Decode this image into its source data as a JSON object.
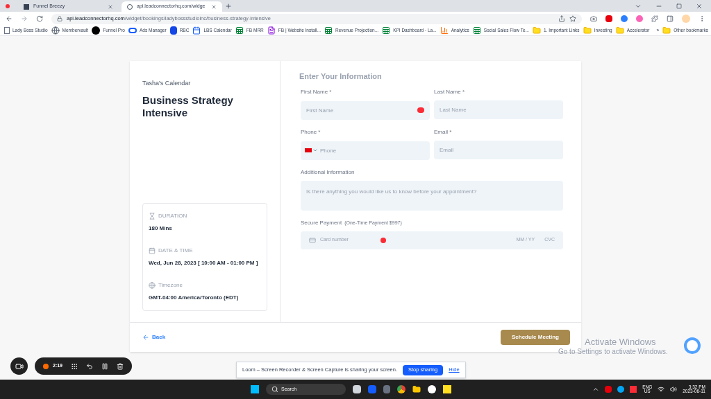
{
  "browser": {
    "tabs": [
      {
        "title": "Funnel Breezy",
        "selected": false
      },
      {
        "title": "api.leadconnectorhq.com/widge",
        "selected": true
      }
    ],
    "address": {
      "domain": "api.leadconnectorhq.com",
      "path": "/widget/bookings/ladybossstudioinc/business-strategy-intensive"
    },
    "bookmarks": [
      {
        "label": "Lady Boss Studio",
        "kind": "logo"
      },
      {
        "label": "Membervault",
        "kind": "globe"
      },
      {
        "label": "Funnel Pro",
        "kind": "dark"
      },
      {
        "label": "Ads Manager",
        "kind": "meta"
      },
      {
        "label": "RBC",
        "kind": "bank"
      },
      {
        "label": "LBS Calendar",
        "kind": "calendar"
      },
      {
        "label": "FB MRR",
        "kind": "sheet"
      },
      {
        "label": "FB | Website Install...",
        "kind": "form"
      },
      {
        "label": "Revenue Projection...",
        "kind": "sheet"
      },
      {
        "label": "KPI Dashboard - La...",
        "kind": "sheet"
      },
      {
        "label": "Analytics",
        "kind": "analytics"
      },
      {
        "label": "Social Sales Flow Te...",
        "kind": "sheet"
      },
      {
        "label": "1. Important Links",
        "kind": "folder"
      },
      {
        "label": "Investing",
        "kind": "folder"
      },
      {
        "label": "Accelerator",
        "kind": "folder"
      }
    ],
    "more": "»",
    "other_bookmarks": "Other bookmarks"
  },
  "booking": {
    "calendar_name": "Tasha's Calendar",
    "title": "Business Strategy Intensive",
    "details": [
      {
        "kind": "duration",
        "label": "DURATION",
        "value": "180 Mins"
      },
      {
        "kind": "datetime",
        "label": "DATE & TIME",
        "value": "Wed, Jun 28, 2023 [ 10:00 AM - 01:00 PM ]"
      },
      {
        "kind": "timezone",
        "label": "Timezone",
        "value": "GMT-04:00 America/Toronto (EDT)"
      }
    ],
    "form_heading": "Enter Your Information",
    "fields": [
      {
        "kind": "text",
        "label": "First Name *",
        "placeholder": "First Name"
      },
      {
        "kind": "text",
        "label": "Last Name *",
        "placeholder": "Last Name"
      },
      {
        "kind": "phone",
        "label": "Phone *",
        "placeholder": "Phone"
      },
      {
        "kind": "text",
        "label": "Email *",
        "placeholder": "Email"
      },
      {
        "kind": "textarea",
        "label": "Additional Information",
        "placeholder": "Is there anything you would like us to know before your appointment?"
      }
    ],
    "payment": {
      "label": "Secure Payment",
      "note": "(One-Time Payment $997)",
      "card_placeholder": "Card number",
      "expiry_placeholder": "MM / YY",
      "cvc_placeholder": "CVC"
    },
    "back": "Back",
    "submit": "Schedule Meeting"
  },
  "activation": {
    "title": "Activate Windows",
    "subtitle": "Go to Settings to activate Windows."
  },
  "loom": {
    "timer": "2:19",
    "banner": "Loom – Screen Recorder & Screen Capture is sharing your screen.",
    "stop": "Stop sharing",
    "hide": "Hide"
  },
  "taskbar": {
    "search": "Search",
    "lang": "ENG",
    "region": "US",
    "time": "3:32 PM",
    "date": "2023-06-11"
  }
}
